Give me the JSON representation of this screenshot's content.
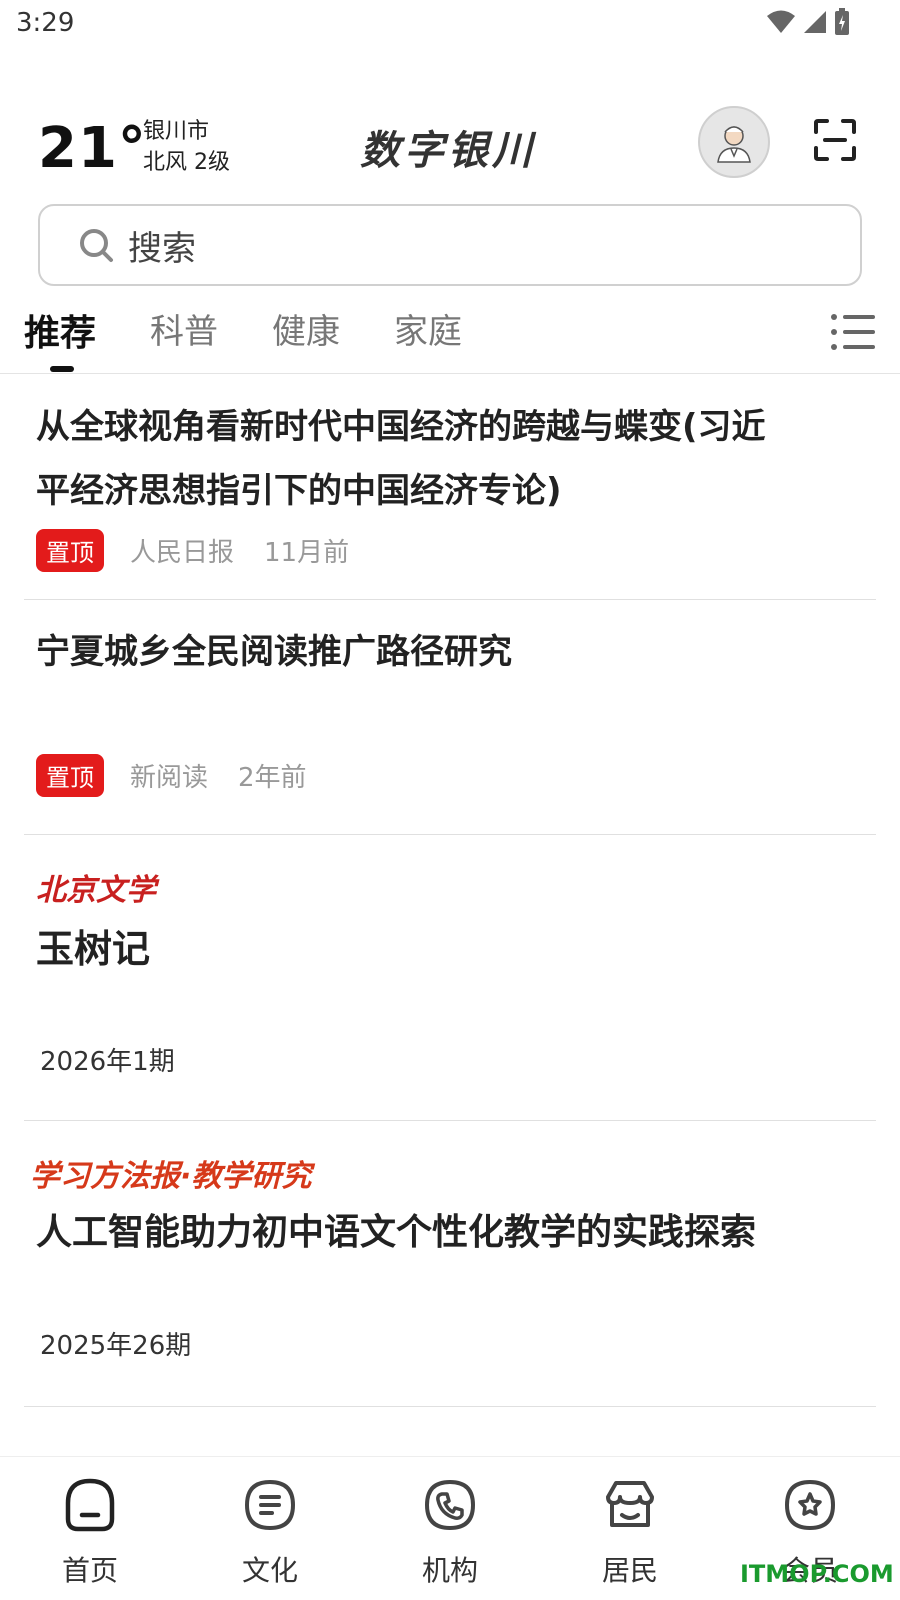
{
  "status_bar": {
    "time": "3:29"
  },
  "header": {
    "temperature": "21°",
    "city": "银川市",
    "wind": "北风  2级",
    "logo_text": "数字银川"
  },
  "search": {
    "placeholder": "搜索"
  },
  "tabs": [
    {
      "label": "推荐",
      "active": true
    },
    {
      "label": "科普",
      "active": false
    },
    {
      "label": "健康",
      "active": false
    },
    {
      "label": "家庭",
      "active": false
    }
  ],
  "feed": [
    {
      "title": "从全球视角看新时代中国经济的跨越与蝶变(习近平经济思想指引下的中国经济专论)",
      "title_line1": "从全球视角看新时代中国经济的跨越与蝶变(习近",
      "title_line2": "平经济思想指引下的中国经济专论)",
      "badge": "置顶",
      "source": "人民日报",
      "time": "11月前"
    },
    {
      "title": "宁夏城乡全民阅读推广路径研究",
      "badge": "置顶",
      "source": "新阅读",
      "time": "2年前"
    },
    {
      "source_logo": "北京文学",
      "title": "玉树记",
      "issue": "2026年1期"
    },
    {
      "source_logo": "学习方法报·教学研究",
      "title": "人工智能助力初中语文个性化教学的实践探索",
      "issue": "2025年26期"
    }
  ],
  "bottom_nav": [
    {
      "label": "首页",
      "icon": "home-icon"
    },
    {
      "label": "文化",
      "icon": "culture-icon"
    },
    {
      "label": "机构",
      "icon": "phone-icon"
    },
    {
      "label": "居民",
      "icon": "resident-icon"
    },
    {
      "label": "会员",
      "icon": "member-icon"
    }
  ],
  "watermark": "ITMOP.COM"
}
